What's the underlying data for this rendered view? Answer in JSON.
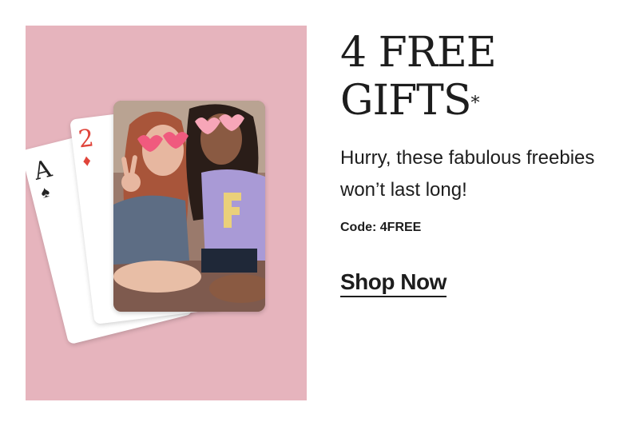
{
  "promo": {
    "headline_line1": "4 FREE",
    "headline_line2": "GIFTS",
    "headline_mark": "*",
    "subtext": "Hurry, these fabulous freebies won’t last long!",
    "code": "Code: 4FREE",
    "cta_label": "Shop Now"
  },
  "cards": {
    "ace": {
      "rank": "A",
      "suit": "♠"
    },
    "two": {
      "rank": "2",
      "suit": "♦"
    }
  },
  "colors": {
    "background_panel": "#e6b4bd",
    "text": "#1d1d1d",
    "card_red": "#e0443a",
    "sunglasses_pink": "#f05a7e"
  },
  "icons": {
    "ace_suit": "spade-icon",
    "two_suit": "diamond-icon"
  }
}
